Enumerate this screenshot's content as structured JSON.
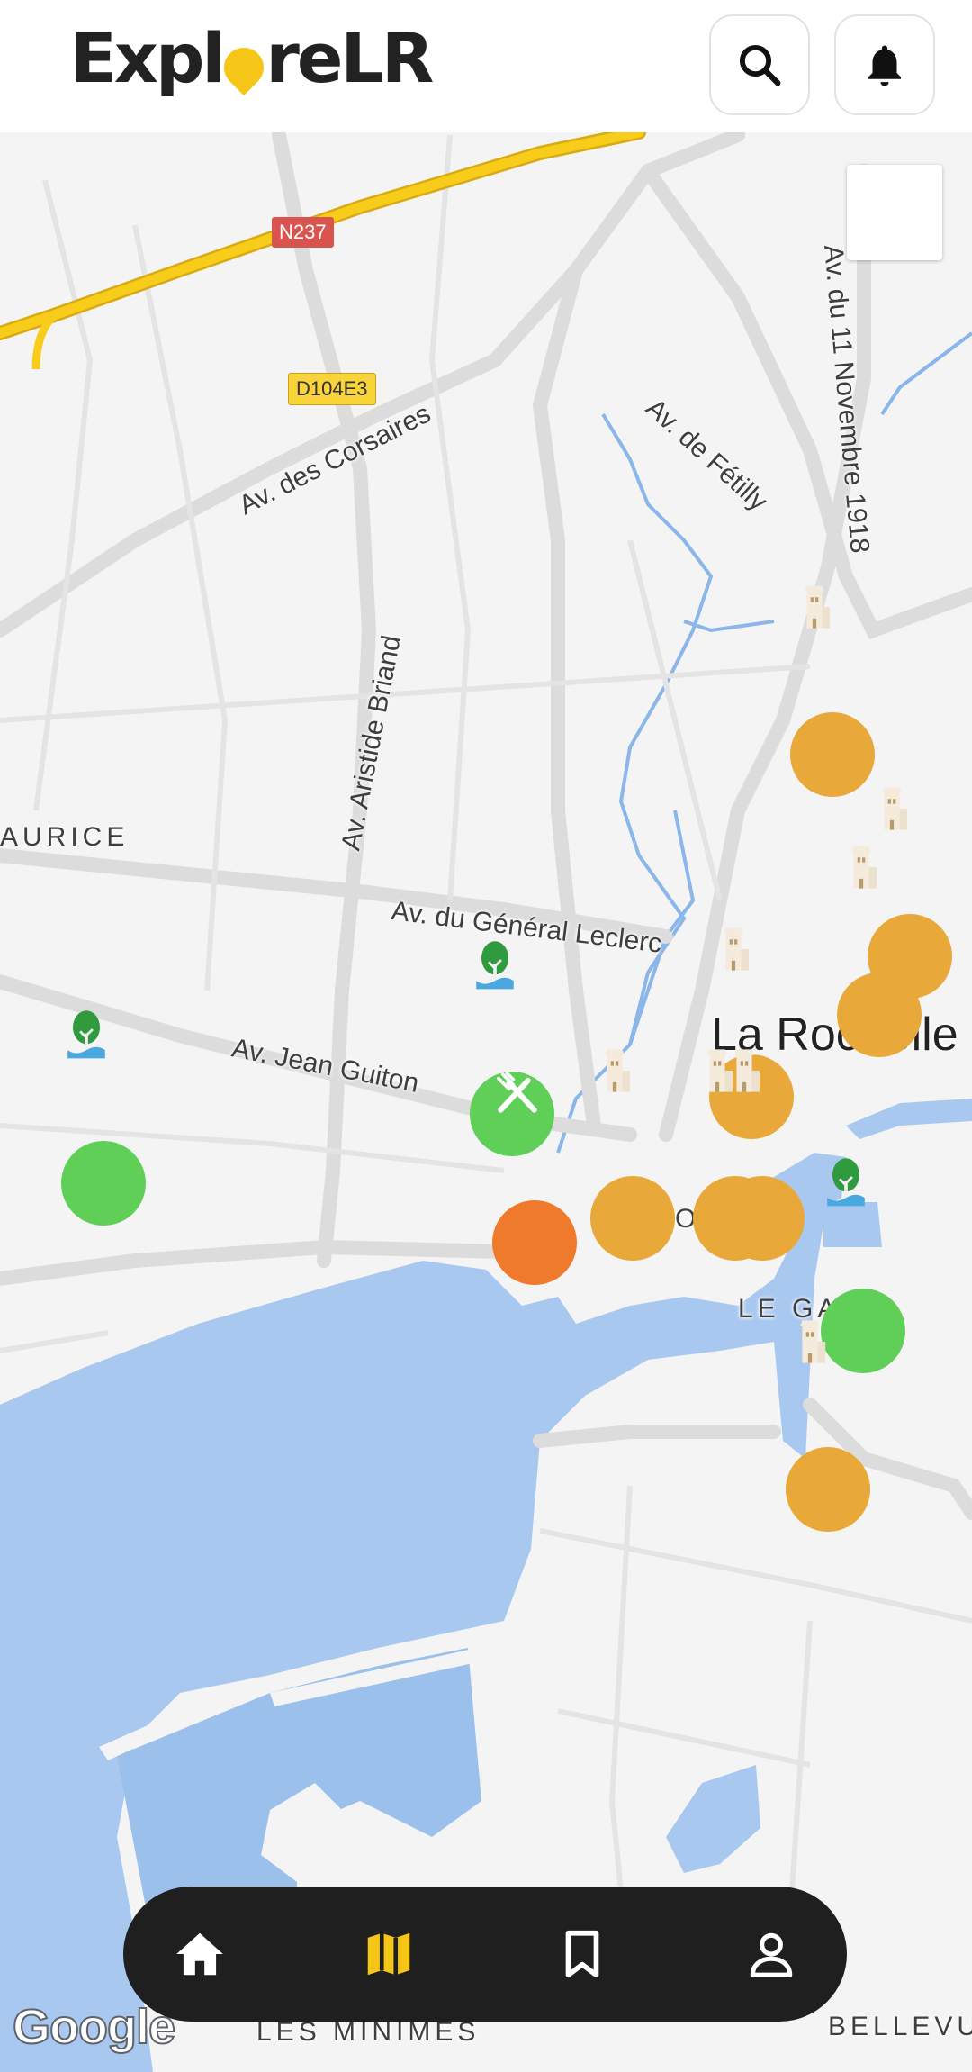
{
  "app": {
    "name_part1": "Expl",
    "name_part2": "reLR"
  },
  "header": {
    "search_icon": "search-icon",
    "notification_icon": "bell-icon"
  },
  "map": {
    "attribution": "Google",
    "roads": {
      "corsaires": "Av. des Corsaires",
      "aristide": "Av. Aristide Briand",
      "fetilly": "Av. de Fétilly",
      "novembre": "Av. du 11 Novembre 1918",
      "leclerc": "Av. du Général Leclerc",
      "guiton": "Av. Jean Guiton"
    },
    "shields": {
      "n237": "N237",
      "d104e3": "D104E3"
    },
    "districts": {
      "maurice": "AURICE",
      "city": "La Rochelle",
      "fort": "ORT",
      "gare": "LE GA",
      "minimes": "LES MINIMES",
      "bellevue": "BELLEVU"
    },
    "colors": {
      "water": "#a8c8f0",
      "motorway": "#f8cc1b",
      "park": "#5fcf58",
      "monument": "#e9a93a",
      "restaurant": "#f07a2c"
    }
  },
  "markers": [
    {
      "type": "monument",
      "icon": "tower-icon"
    },
    {
      "type": "monument",
      "icon": "tower-icon"
    },
    {
      "type": "monument",
      "icon": "tower-icon"
    },
    {
      "type": "monument",
      "icon": "tower-icon"
    },
    {
      "type": "park",
      "icon": "tree-icon"
    },
    {
      "type": "park",
      "icon": "tree-icon"
    },
    {
      "type": "restaurant",
      "icon": "fork-knife-icon"
    },
    {
      "type": "monument",
      "icon": "tower-icon"
    },
    {
      "type": "monument",
      "icon": "tower-icon"
    },
    {
      "type": "monument",
      "icon": "tower-icon"
    },
    {
      "type": "park",
      "icon": "tree-icon"
    },
    {
      "type": "monument",
      "icon": "tower-icon"
    }
  ],
  "nav": {
    "active": "map",
    "items": [
      {
        "name": "home",
        "icon": "home-icon"
      },
      {
        "name": "map",
        "icon": "map-icon"
      },
      {
        "name": "saved",
        "icon": "bookmark-icon"
      },
      {
        "name": "profile",
        "icon": "profile-icon"
      }
    ]
  }
}
